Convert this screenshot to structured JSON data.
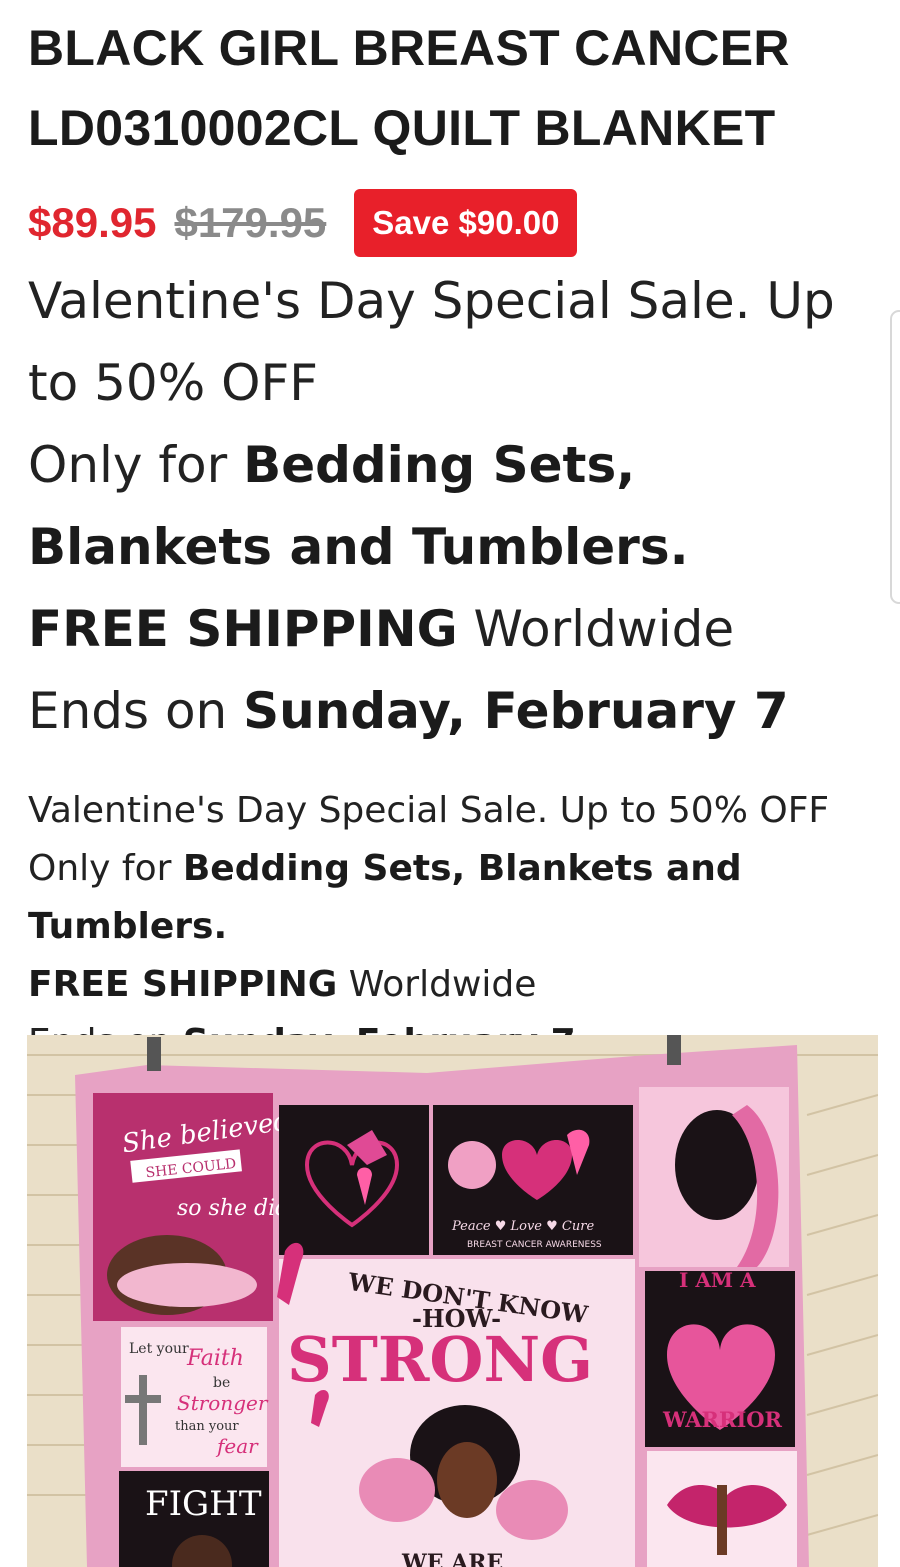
{
  "product": {
    "title": "BLACK GIRL BREAST CANCER LD0310002CL QUILT BLANKET",
    "price_sale": "$89.95",
    "price_regular": "$179.95",
    "save_label": "Save $90.00"
  },
  "promo": {
    "line1": "Valentine's Day Special Sale. Up to 50% OFF",
    "line2_prefix": "Only for ",
    "line2_bold": "Bedding Sets, Blankets and Tumblers.",
    "line3_bold": "FREE SHIPPING",
    "line3_suffix": " Worldwide",
    "line4_prefix": "Ends on ",
    "line4_bold": "Sunday, February 7"
  },
  "image": {
    "texts": {
      "she_believed": "She believed",
      "she_could": "SHE COULD",
      "so_she_did": "so she did.",
      "peace_love_care": "Peace ♥ Love ♥ Cure",
      "awareness": "BREAST CANCER AWARENESS",
      "we_dont_know": "WE DON'T KNOW",
      "how": "-HOW-",
      "strong": "STRONG",
      "we_are": "WE ARE",
      "i_am_a": "I AM A",
      "warrior": "WARRIOR",
      "let_your": "Let your",
      "faith": "Faith",
      "be": "be",
      "stronger": "Stronger",
      "than_your": "than your",
      "fear": "fear",
      "fight": "FIGHT"
    },
    "colors": {
      "wall": "#e9dcc2",
      "quilt_border": "#e7a2c4",
      "hot_pink": "#d6307a",
      "dark_block": "#1a1216",
      "light_pink": "#f6d9e7",
      "magenta": "#b8306e"
    }
  }
}
